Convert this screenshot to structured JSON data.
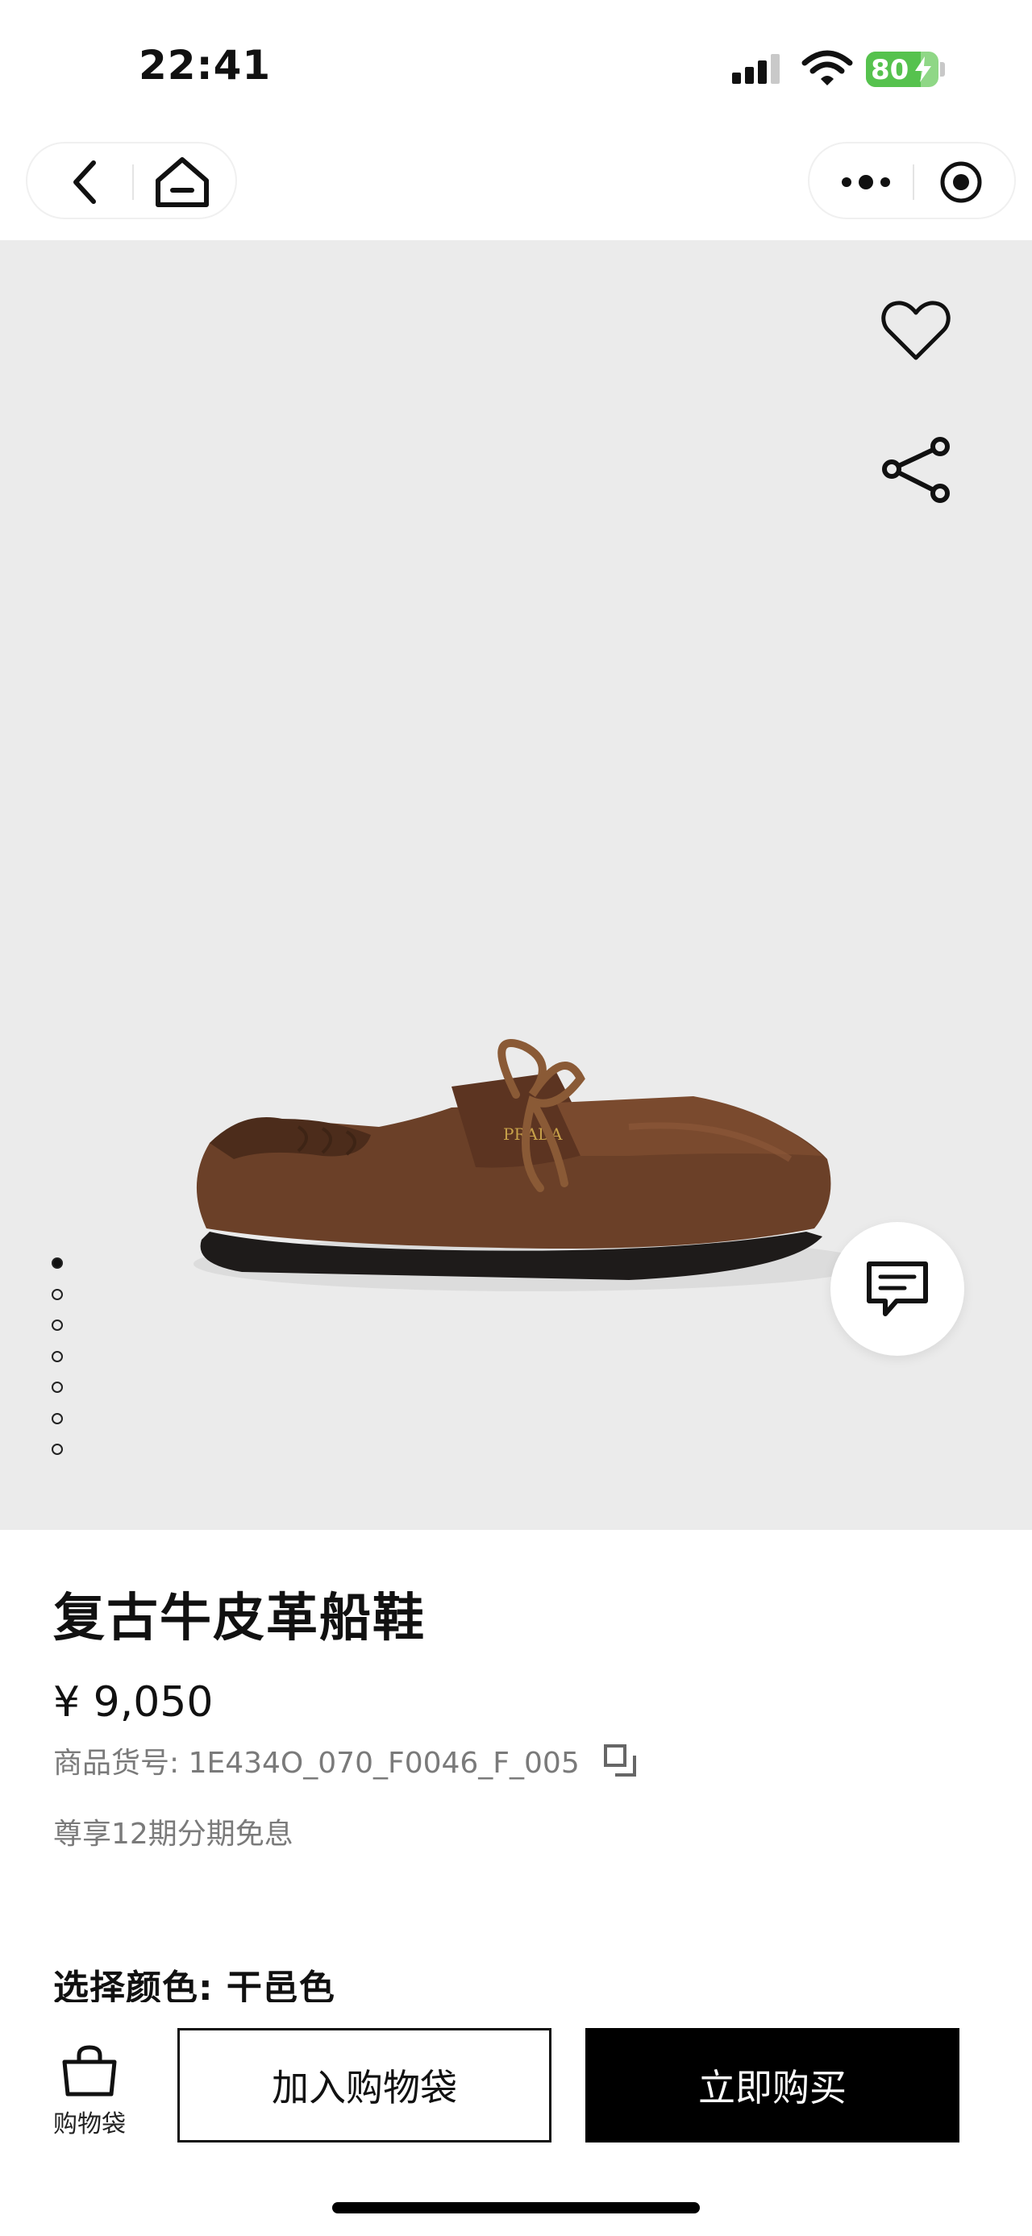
{
  "status_bar": {
    "time": "22:41",
    "battery_level": "80",
    "icons": [
      "signal-icon",
      "wifi-icon",
      "battery-icon",
      "charging-bolt-icon"
    ]
  },
  "nav": {
    "icons": [
      "back-icon",
      "home-icon",
      "more-icon",
      "capsule-close-icon"
    ]
  },
  "hero": {
    "image": "brown-leather-boat-shoe",
    "icons": [
      "heart-icon",
      "share-icon",
      "chat-icon"
    ],
    "carousel": {
      "total": 7,
      "active": 1
    }
  },
  "product": {
    "title": "复古牛皮革船鞋",
    "price": "¥ 9,050",
    "sku": "商品货号: 1E434O_070_F0046_F_005",
    "installment": "尊享12期分期免息",
    "color_label": "选择颜色: 干邑色"
  },
  "bottom_bar": {
    "bag_label": "购物袋",
    "add_to_cart": "加入购物袋",
    "buy_now": "立即购买"
  },
  "colors": {
    "hero_bg": "#ebebeb",
    "battery_green": "#56c24e",
    "shoe_brown": "#6b4028",
    "primary_black": "#000000",
    "secondary_text": "#7a7a7a"
  }
}
